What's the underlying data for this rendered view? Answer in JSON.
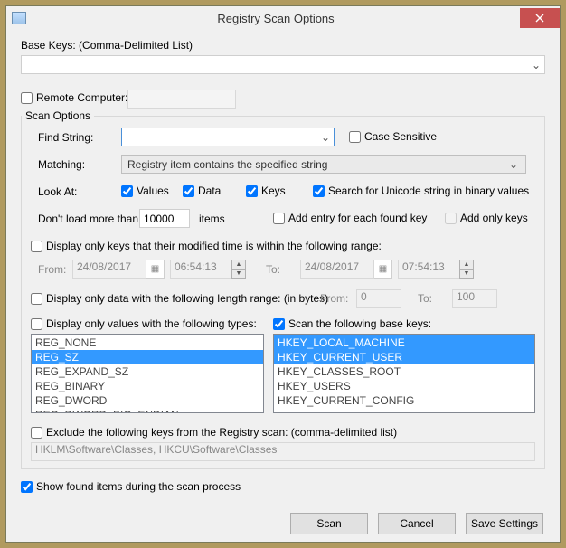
{
  "window": {
    "title": "Registry Scan Options"
  },
  "baseKeys": {
    "label": "Base Keys:  (Comma-Delimited List)",
    "value": ""
  },
  "remote": {
    "label": "Remote Computer:",
    "checked": false,
    "value": ""
  },
  "scanOptions": {
    "legend": "Scan Options",
    "findString": {
      "label": "Find String:",
      "value": ""
    },
    "caseSensitive": {
      "label": "Case Sensitive",
      "checked": false
    },
    "matching": {
      "label": "Matching:",
      "value": "Registry item contains the specified string"
    },
    "lookAt": {
      "label": "Look At:",
      "values": {
        "label": "Values",
        "checked": true
      },
      "data": {
        "label": "Data",
        "checked": true
      },
      "keys": {
        "label": "Keys",
        "checked": true
      },
      "unicode": {
        "label": "Search for Unicode string in binary values",
        "checked": true
      }
    },
    "dontLoad": {
      "label1": "Don't load more than",
      "value": "10000",
      "label2": "items"
    },
    "addEntry": {
      "label": "Add entry for each found key",
      "checked": false
    },
    "addOnlyKeys": {
      "label": "Add only keys",
      "checked": false
    },
    "modTime": {
      "enable": {
        "label": "Display only keys that their modified time is within the following range:",
        "checked": false
      },
      "fromLabel": "From:",
      "fromDate": "24/08/2017",
      "fromTime": "06:54:13",
      "toLabel": "To:",
      "toDate": "24/08/2017",
      "toTime": "07:54:13"
    },
    "lenRange": {
      "label": "Display only data with the following length range: (in bytes)",
      "checked": false,
      "fromLabel": "From:",
      "fromValue": "0",
      "toLabel": "To:",
      "toValue": "100"
    },
    "valTypes": {
      "label": "Display only values with the following types:",
      "checked": false,
      "items": [
        "REG_NONE",
        "REG_SZ",
        "REG_EXPAND_SZ",
        "REG_BINARY",
        "REG_DWORD",
        "REG_DWORD_BIG_ENDIAN"
      ],
      "selected": [
        1
      ]
    },
    "baseScan": {
      "label": "Scan the following base keys:",
      "checked": true,
      "items": [
        "HKEY_LOCAL_MACHINE",
        "HKEY_CURRENT_USER",
        "HKEY_CLASSES_ROOT",
        "HKEY_USERS",
        "HKEY_CURRENT_CONFIG"
      ],
      "selected": [
        0,
        1
      ]
    },
    "exclude": {
      "label": "Exclude the following keys from the Registry scan: (comma-delimited list)",
      "checked": false,
      "value": "HKLM\\Software\\Classes, HKCU\\Software\\Classes"
    }
  },
  "showFound": {
    "label": "Show found items during the scan process",
    "checked": true
  },
  "buttons": {
    "scan": "Scan",
    "cancel": "Cancel",
    "save": "Save Settings"
  }
}
